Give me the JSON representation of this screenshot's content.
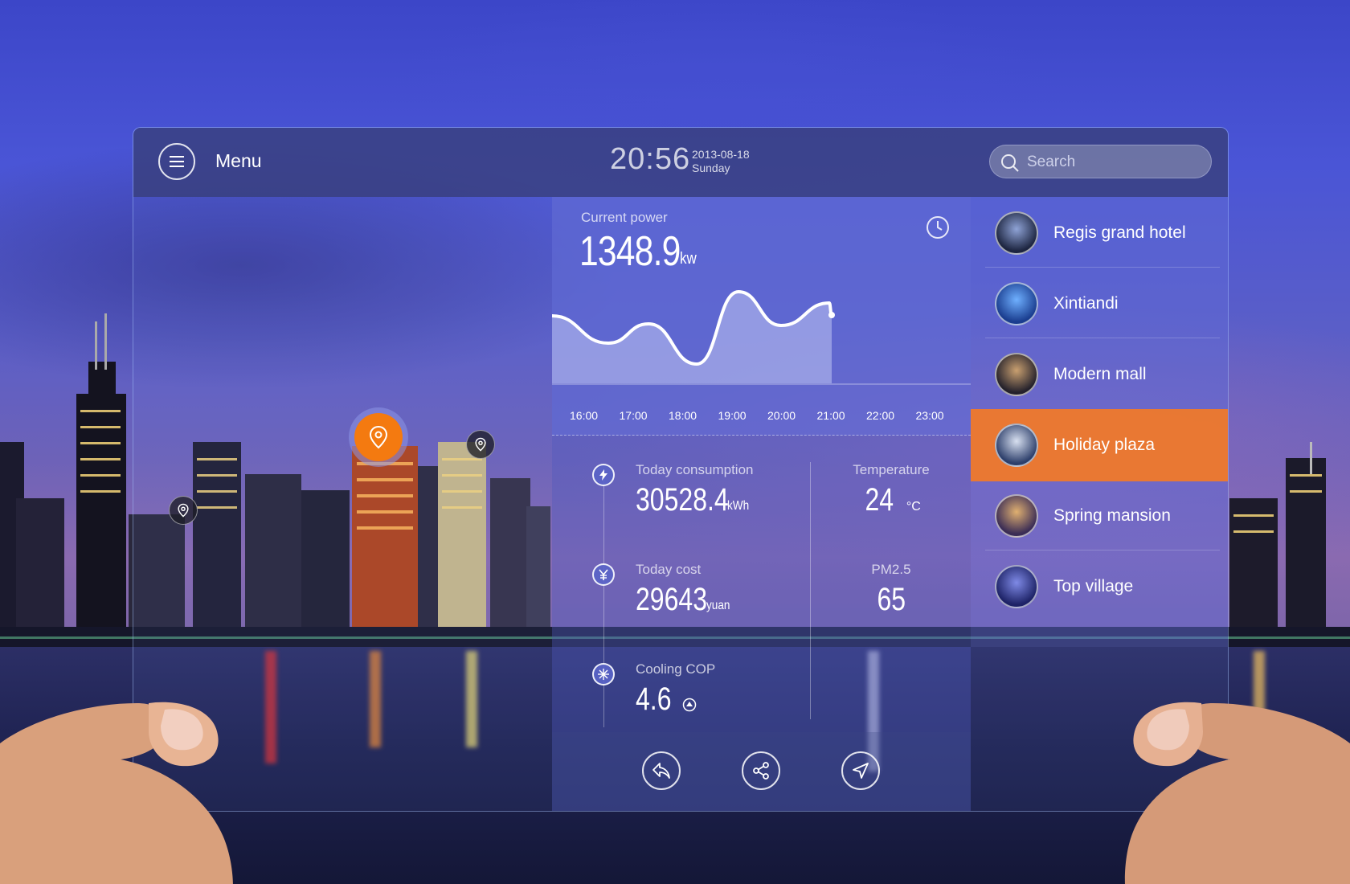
{
  "topbar": {
    "menu_label": "Menu",
    "time": "20:56",
    "date": "2013-08-18",
    "weekday": "Sunday",
    "search_placeholder": "Search"
  },
  "power": {
    "label": "Current power",
    "value": "1348.9",
    "unit": "kw"
  },
  "chart_data": {
    "type": "area",
    "x": [
      "16:00",
      "17:00",
      "18:00",
      "19:00",
      "20:00",
      "21:00",
      "22:00",
      "23:00"
    ],
    "series_shape": [
      0.5,
      0.3,
      0.05,
      0.9,
      0.6,
      0.75
    ],
    "series_x": [
      "15:40",
      "16:30",
      "17:20",
      "18:10",
      "19:05",
      "19:55",
      "20:50",
      "21:00"
    ]
  },
  "stats": {
    "consumption": {
      "label": "Today consumption",
      "value": "30528.4",
      "unit": "kWh",
      "icon": "bolt-icon"
    },
    "cost": {
      "label": "Today cost",
      "value": "29643",
      "unit": "yuan",
      "icon": "yuan-icon"
    },
    "cop": {
      "label": "Cooling COP",
      "value": "4.6",
      "icon": "snowflake-icon"
    },
    "temperature": {
      "label": "Temperature",
      "value": "24",
      "unit": "°C"
    },
    "pm25": {
      "label": "PM2.5",
      "value": "65"
    }
  },
  "actions": [
    "back-icon",
    "share-icon",
    "navigate-icon"
  ],
  "locations": [
    {
      "name": "Regis grand hotel",
      "active": false
    },
    {
      "name": "Xintiandi",
      "active": false
    },
    {
      "name": "Modern mall",
      "active": false
    },
    {
      "name": "Holiday plaza",
      "active": true
    },
    {
      "name": "Spring mansion",
      "active": false
    },
    {
      "name": "Top village",
      "active": false
    }
  ],
  "colors": {
    "accent": "#f47a10",
    "active_row": "#f27a28",
    "panel": "#5f69d2"
  }
}
